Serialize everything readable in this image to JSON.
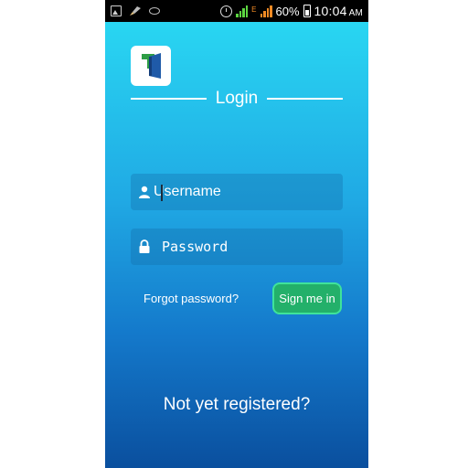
{
  "status_bar": {
    "battery_percent": "60%",
    "time": "10:04",
    "ampm": "AM",
    "network_label": "E",
    "icons": [
      "image-icon",
      "brush-icon",
      "eye-icon",
      "alarm-icon",
      "signal-icon",
      "signal-icon",
      "battery-icon"
    ]
  },
  "login": {
    "title": "Login",
    "username_placeholder": "Username",
    "password_placeholder": "Password",
    "forgot_label": "Forgot password?",
    "signin_label": "Sign me in",
    "register_label": "Not yet registered?"
  },
  "colors": {
    "gradient_top": "#29d6f2",
    "gradient_bottom": "#0a4f9e",
    "signin_bg": "#23b06a",
    "signin_border": "#3fe39a",
    "logo_green": "#2e9e45",
    "logo_blue": "#1f5aa8"
  }
}
